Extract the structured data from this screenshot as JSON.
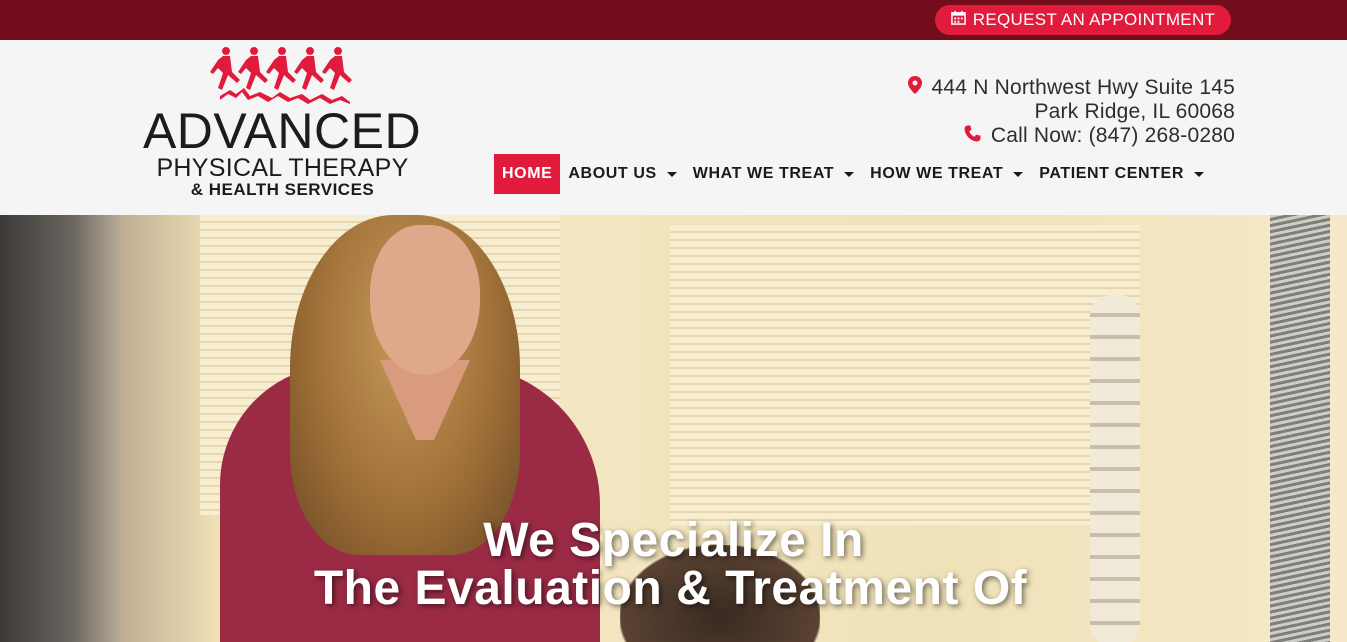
{
  "topbar": {
    "appointment_label": "REQUEST AN APPOINTMENT",
    "appointment_icon": "calendar-icon"
  },
  "logo": {
    "line1": "ADVANCED",
    "line2": "PHYSICAL THERAPY",
    "line3": "& HEALTH SERVICES",
    "accent_color": "#e01b3c"
  },
  "contact": {
    "address_line1": "444 N Northwest Hwy Suite 145",
    "address_line2": "Park Ridge, IL 60068",
    "phone": "Call Now: (847) 268-0280"
  },
  "nav": {
    "items": [
      {
        "label": "HOME",
        "active": true
      },
      {
        "label": "ABOUT US",
        "dropdown": true
      },
      {
        "label": "WHAT WE TREAT",
        "dropdown": true
      },
      {
        "label": "HOW WE TREAT",
        "dropdown": true
      },
      {
        "label": "PATIENT CENTER",
        "dropdown": true
      }
    ]
  },
  "hero": {
    "headline_line1": "We Specialize In",
    "headline_line2": "The Evaluation & Treatment Of"
  },
  "colors": {
    "topbar": "#730c1b",
    "accent": "#e01b3c",
    "text": "#1a1a1a"
  }
}
